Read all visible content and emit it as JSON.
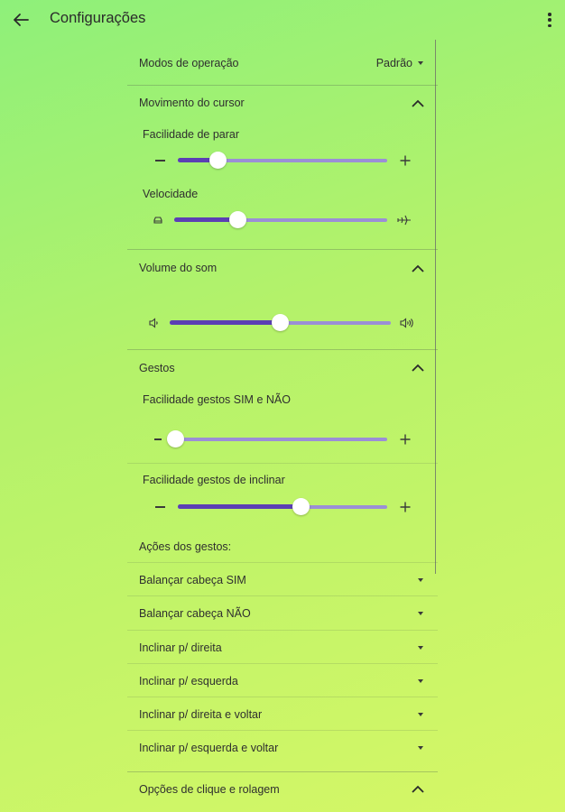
{
  "header": {
    "title": "Configurações",
    "back_icon": "arrow-left-icon",
    "menu_icon": "more-vert-icon"
  },
  "modes": {
    "label": "Modos de operação",
    "value": "Padrão"
  },
  "cursor": {
    "title": "Movimento do cursor",
    "stop_ease": {
      "label": "Facilidade de parar",
      "value": 0.19
    },
    "speed": {
      "label": "Velocidade",
      "value": 0.3,
      "min_icon": "car-icon",
      "max_icon": "airplane-icon"
    }
  },
  "sound": {
    "title": "Volume do som",
    "volume": {
      "value": 0.5,
      "min_icon": "volume-low-icon",
      "max_icon": "volume-high-icon"
    }
  },
  "gestures": {
    "title": "Gestos",
    "yes_no_ease": {
      "label": "Facilidade gestos SIM e NÃO",
      "value": 0.0
    },
    "tilt_ease": {
      "label": "Facilidade gestos de inclinar",
      "value": 0.59
    },
    "actions_label": "Ações dos gestos:",
    "actions": [
      "Balançar cabeça SIM",
      "Balançar cabeça NÃO",
      "Inclinar p/ direita",
      "Inclinar p/ esquerda",
      "Inclinar p/ direita e voltar",
      "Inclinar p/ esquerda e voltar"
    ]
  },
  "click_scroll": {
    "title": "Opções de clique e rolagem"
  },
  "colors": {
    "slider_active": "#5b3fb4",
    "slider_inactive": "#9b8fd6",
    "background_start": "#8ef07a",
    "background_end": "#d6f766"
  }
}
